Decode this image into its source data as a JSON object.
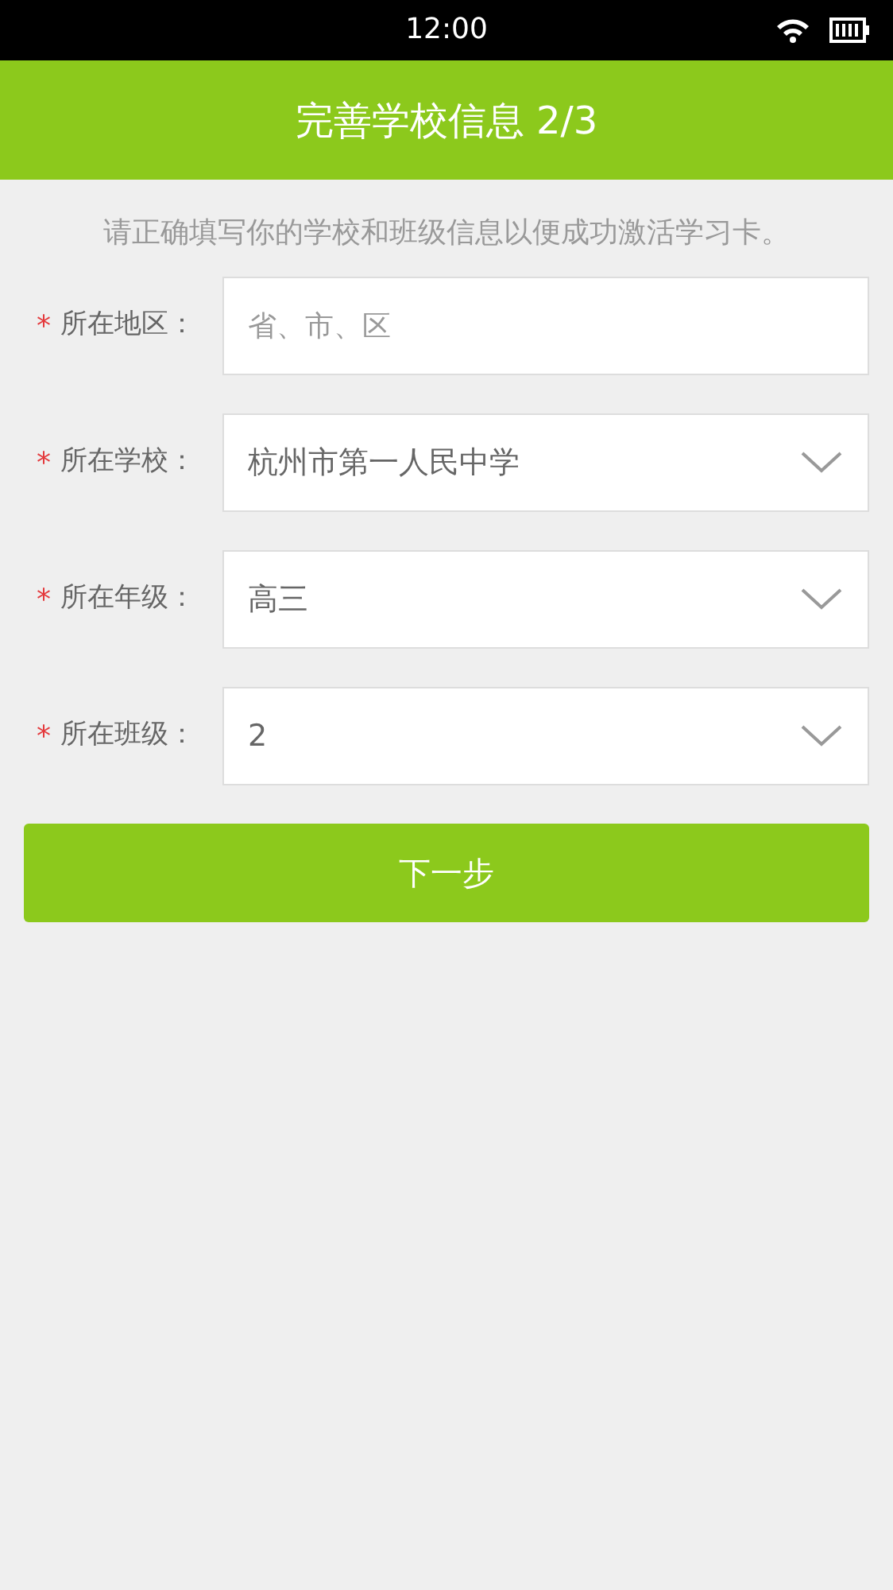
{
  "status_bar": {
    "time": "12:00"
  },
  "header": {
    "title": "完善学校信息 2/3"
  },
  "instruction": "请正确填写你的学校和班级信息以便成功激活学习卡。",
  "fields": [
    {
      "kind": "input",
      "required_mark": "*",
      "label": "所在地区：",
      "placeholder": "省、市、区"
    },
    {
      "kind": "select",
      "required_mark": "*",
      "label": "所在学校：",
      "value": "杭州市第一人民中学"
    },
    {
      "kind": "select",
      "required_mark": "*",
      "label": "所在年级：",
      "value": "高三"
    },
    {
      "kind": "select",
      "required_mark": "*",
      "label": "所在班级：",
      "value": "2"
    }
  ],
  "next_button": "下一步"
}
